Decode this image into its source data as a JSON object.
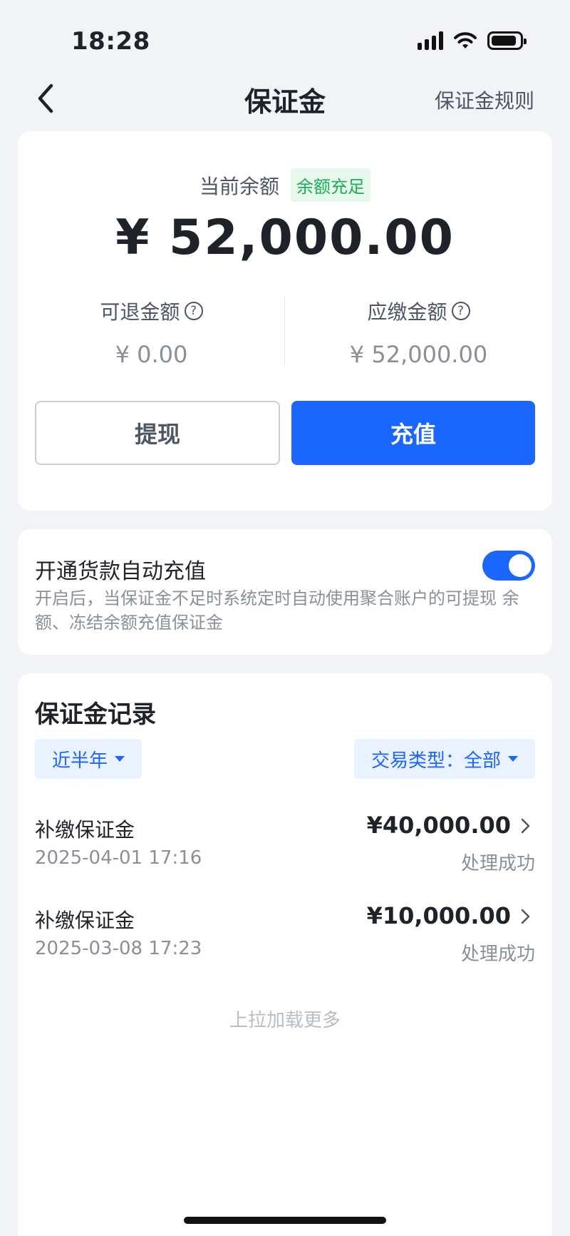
{
  "status_bar": {
    "time": "18:28",
    "signal_icon": "cellular-signal-icon",
    "wifi_icon": "wifi-icon",
    "battery_icon": "battery-icon",
    "battery_level": 0.9
  },
  "nav": {
    "back_icon": "chevron-left-icon",
    "title": "保证金",
    "rules_link": "保证金规则"
  },
  "balance": {
    "label": "当前余额",
    "badge": "余额充足",
    "amount": "¥ 52,000.00",
    "refundable_label": "可退金额",
    "refundable_value": "¥ 0.00",
    "payable_label": "应缴金额",
    "payable_value": "¥ 52,000.00",
    "help_icon": "question-circle-icon",
    "withdraw_button": "提现",
    "recharge_button": "充值"
  },
  "auto_recharge": {
    "title": "开通货款自动充值",
    "enabled": true,
    "description": "开启后，当保证金不足时系统定时自动使用聚合账户的可提现 余额、冻结余额充值保证金"
  },
  "records": {
    "title": "保证金记录",
    "filter_period": "近半年",
    "filter_type": "交易类型：全部",
    "items": [
      {
        "name": "补缴保证金",
        "date": "2025-04-01 17:16",
        "amount": "¥40,000.00",
        "status": "处理成功"
      },
      {
        "name": "补缴保证金",
        "date": "2025-03-08 17:23",
        "amount": "¥10,000.00",
        "status": "处理成功"
      }
    ],
    "load_more": "上拉加载更多"
  },
  "colors": {
    "accent": "#1a66ff",
    "success": "#1fad5b",
    "background": "#f2f3f7"
  }
}
